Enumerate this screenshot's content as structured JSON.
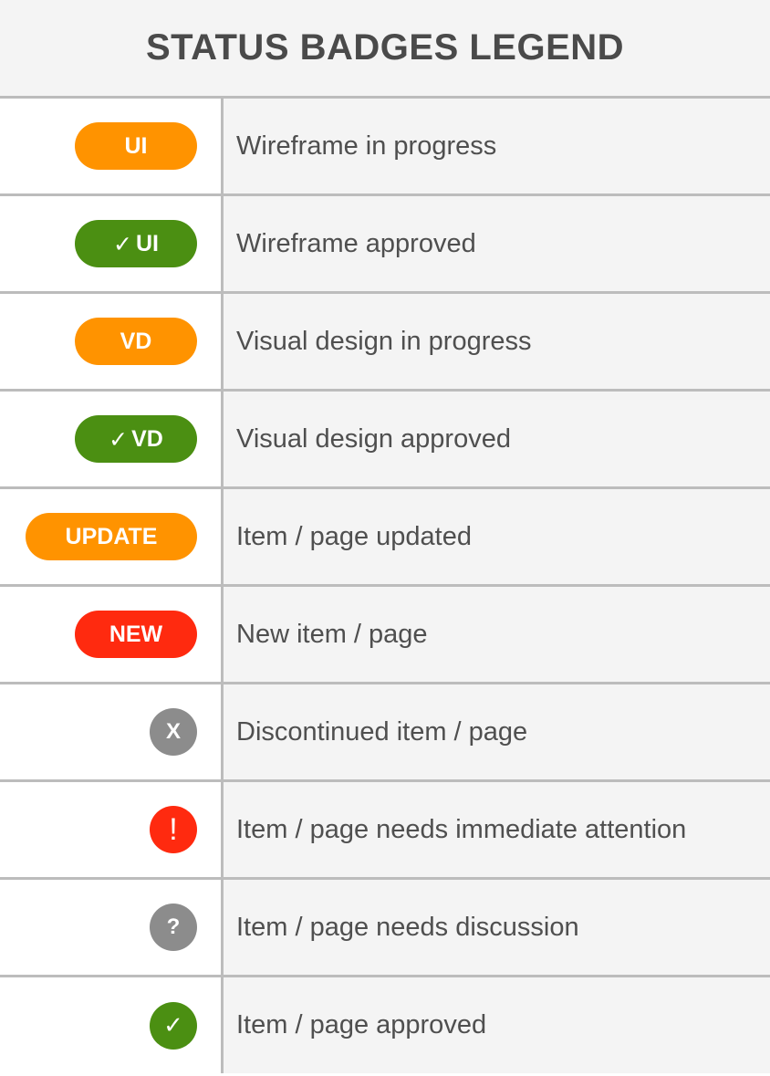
{
  "header": {
    "title": "STATUS BADGES LEGEND"
  },
  "colors": {
    "orange": "#ff9300",
    "green": "#4b8f12",
    "red": "#ff2a0f",
    "gray": "#8c8c8c",
    "grid": "#bcbcbc",
    "row_bg": "#f4f4f4",
    "text": "#4f4f4f",
    "title": "#4a4a4a"
  },
  "rows": [
    {
      "badge": "UI",
      "check": false,
      "shape": "pill",
      "color": "orange",
      "description": "Wireframe in progress"
    },
    {
      "badge": "UI",
      "check": true,
      "shape": "pill",
      "color": "green",
      "description": "Wireframe approved"
    },
    {
      "badge": "VD",
      "check": false,
      "shape": "pill",
      "color": "orange",
      "description": "Visual design in progress"
    },
    {
      "badge": "VD",
      "check": true,
      "shape": "pill",
      "color": "green",
      "description": "Visual design approved"
    },
    {
      "badge": "UPDATE",
      "check": false,
      "shape": "pill-wide",
      "color": "orange",
      "description": "Item / page updated"
    },
    {
      "badge": "NEW",
      "check": false,
      "shape": "pill",
      "color": "red",
      "description": "New item / page"
    },
    {
      "badge": "X",
      "check": false,
      "shape": "circle",
      "color": "gray",
      "description": "Discontinued item / page"
    },
    {
      "badge": "!",
      "check": false,
      "shape": "circle",
      "color": "red",
      "description": "Item / page needs immediate attention"
    },
    {
      "badge": "?",
      "check": false,
      "shape": "circle",
      "color": "gray",
      "description": "Item / page needs discussion"
    },
    {
      "badge": "",
      "check": true,
      "shape": "circle",
      "color": "green",
      "description": "Item / page approved"
    }
  ]
}
